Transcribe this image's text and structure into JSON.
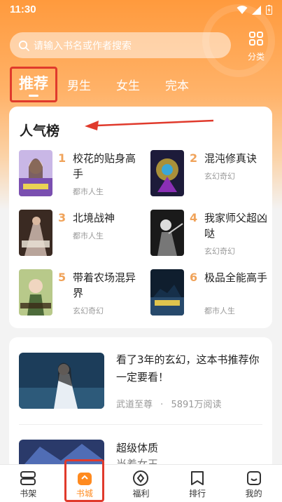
{
  "status_bar": {
    "time": "11:30"
  },
  "search": {
    "placeholder": "请输入书名或作者搜索"
  },
  "category": {
    "label": "分类"
  },
  "tabs": [
    {
      "label": "推荐",
      "active": true
    },
    {
      "label": "男生"
    },
    {
      "label": "女生"
    },
    {
      "label": "完本"
    }
  ],
  "ranking": {
    "title": "人气榜",
    "books": [
      {
        "rank": "1",
        "title": "校花的贴身高手",
        "genre": "都市人生"
      },
      {
        "rank": "2",
        "title": "混沌修真诀",
        "genre": "玄幻奇幻"
      },
      {
        "rank": "3",
        "title": "北境战神",
        "genre": "都市人生"
      },
      {
        "rank": "4",
        "title": "我家师父超凶哒",
        "genre": "玄幻奇幻"
      },
      {
        "rank": "5",
        "title": "带着农场混异界",
        "genre": "玄幻奇幻"
      },
      {
        "rank": "6",
        "title": "极品全能高手",
        "genre": "都市人生"
      }
    ]
  },
  "recommend": {
    "items": [
      {
        "title": "看了3年的玄幻，这本书推荐你一定要看！",
        "author": "武道至尊",
        "separator": "·",
        "reads": "5891万阅读"
      },
      {
        "title": "超级体质",
        "subtitle": "当着女王"
      }
    ]
  },
  "bottom_nav": [
    {
      "label": "书架"
    },
    {
      "label": "书城",
      "active": true
    },
    {
      "label": "福利"
    },
    {
      "label": "排行"
    },
    {
      "label": "我的"
    }
  ],
  "colors": {
    "accent": "#ff8a1f",
    "highlight_box": "#e03a2c",
    "rank_number": "#f0a35a"
  }
}
